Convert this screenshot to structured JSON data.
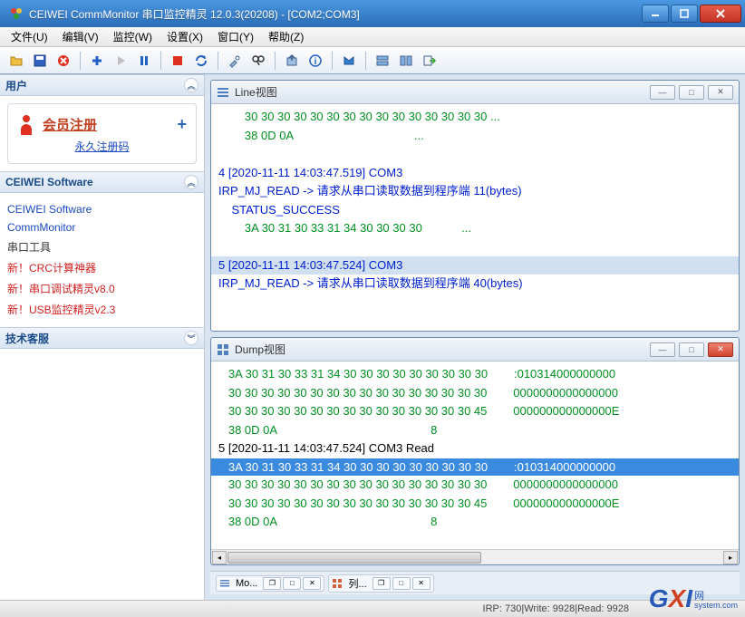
{
  "title": "CEIWEI CommMonitor 串口监控精灵 12.0.3(20208) - [COM2;COM3]",
  "menu": {
    "file": "文件(U)",
    "edit": "编辑(V)",
    "monitor": "监控(W)",
    "settings": "设置(X)",
    "window": "窗口(Y)",
    "help": "帮助(Z)"
  },
  "sidebar": {
    "user_hdr": "用户",
    "member_register": "会员注册",
    "perm_code": "永久注册码",
    "software_hdr": "CEIWEI Software",
    "links": {
      "ceiwei": "CEIWEI Software",
      "comm": "CommMonitor",
      "tools": "串口工具",
      "new1": "新！CRC计算神器",
      "new2": "新！串口调试精灵v8.0",
      "new3": "新！USB监控精灵v2.3"
    },
    "support_hdr": "技术客服"
  },
  "lineview": {
    "title": "Line视图",
    "lines": [
      {
        "cls": "g",
        "text": "        30 30 30 30 30 30 30 30 30 30 30 30 30 30 30 ..."
      },
      {
        "cls": "g",
        "text": "        38 0D 0A                                     ..."
      },
      {
        "cls": "",
        "text": ""
      },
      {
        "cls": "b",
        "text": "4 [2020-11-11 14:03:47.519] COM3"
      },
      {
        "cls": "b",
        "text": "IRP_MJ_READ -> 请求从串口读取数据到程序端 11(bytes)"
      },
      {
        "cls": "b",
        "text": "    STATUS_SUCCESS"
      },
      {
        "cls": "g",
        "text": "        3A 30 31 30 33 31 34 30 30 30 30            ..."
      },
      {
        "cls": "",
        "text": ""
      },
      {
        "cls": "b hl",
        "text": "5 [2020-11-11 14:03:47.524] COM3"
      },
      {
        "cls": "b",
        "text": "IRP_MJ_READ -> 请求从串口读取数据到程序端 40(bytes)"
      }
    ]
  },
  "dumpview": {
    "title": "Dump视图",
    "lines": [
      {
        "cls": "g",
        "hex": "   3A 30 31 30 33 31 34 30 30 30 30 30 30 30 30 30",
        "ascii": ":010314000000000"
      },
      {
        "cls": "g",
        "hex": "   30 30 30 30 30 30 30 30 30 30 30 30 30 30 30 30",
        "ascii": "0000000000000000"
      },
      {
        "cls": "g",
        "hex": "   30 30 30 30 30 30 30 30 30 30 30 30 30 30 30 45",
        "ascii": "000000000000000E"
      },
      {
        "cls": "g",
        "hex": "   38 0D 0A",
        "ascii": "8"
      },
      {
        "cls": "bk",
        "hex": "5 [2020-11-11 14:03:47.524] COM3 Read",
        "ascii": ""
      },
      {
        "cls": "g hlsel",
        "hex": "   3A 30 31 30 33 31 34 30 30 30 30 30 30 30 30 30",
        "ascii": ":010314000000000"
      },
      {
        "cls": "g",
        "hex": "   30 30 30 30 30 30 30 30 30 30 30 30 30 30 30 30",
        "ascii": "0000000000000000"
      },
      {
        "cls": "g",
        "hex": "   30 30 30 30 30 30 30 30 30 30 30 30 30 30 30 45",
        "ascii": "000000000000000E"
      },
      {
        "cls": "g",
        "hex": "   38 0D 0A",
        "ascii": "8"
      }
    ]
  },
  "tabs": {
    "mo": "Mo...",
    "list": "列..."
  },
  "status": {
    "irp": "IRP: 730",
    "write": "Write: 9928",
    "read": "Read: 9928"
  },
  "logo": {
    "g": "G",
    "x": "X",
    "i": "I",
    "cn": "网",
    "en": "system.com"
  }
}
